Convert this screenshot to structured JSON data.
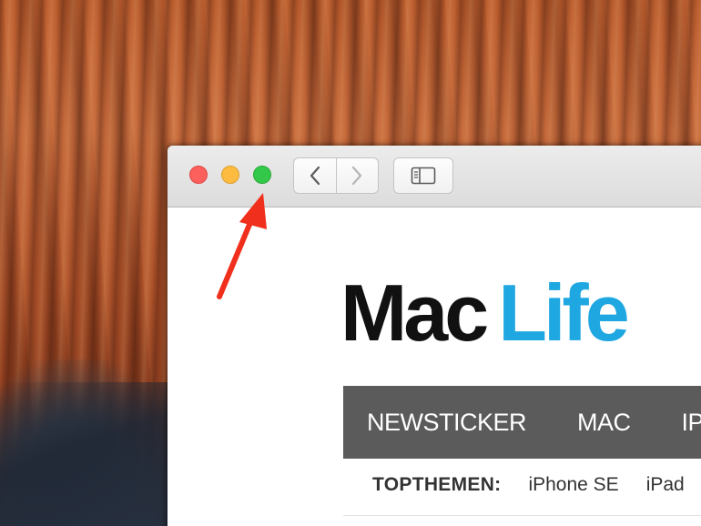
{
  "window": {
    "title_bar": {
      "close_icon": "close-circle",
      "minimize_icon": "minimize-circle",
      "zoom_icon": "zoom-circle",
      "back_icon": "chevron-left",
      "forward_icon": "chevron-right",
      "sidebar_icon": "sidebar-toggle"
    }
  },
  "site": {
    "logo_mac": "Mac",
    "logo_life": "Life",
    "nav": [
      {
        "label": "NEWSTICKER"
      },
      {
        "label": "MAC"
      },
      {
        "label": "IP"
      }
    ],
    "topthemen_label": "TOPTHEMEN:",
    "topics": [
      {
        "label": "iPhone SE"
      },
      {
        "label": "iPad"
      }
    ]
  },
  "colors": {
    "accent_blue": "#1ea7e1",
    "nav_bg": "#5b5b5b",
    "arrow_red": "#f0301c",
    "traffic_close": "#fc605c",
    "traffic_min": "#fdbc40",
    "traffic_zoom": "#34c84a"
  }
}
